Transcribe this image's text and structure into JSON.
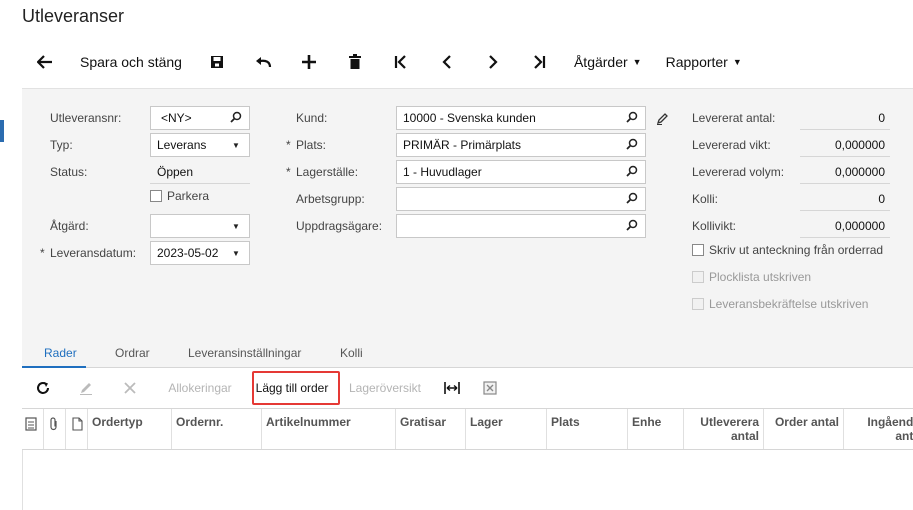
{
  "page": {
    "title": "Utleveranser"
  },
  "toolbar": {
    "save_close_label": "Spara och stäng",
    "actions_label": "Åtgärder",
    "reports_label": "Rapporter",
    "icons": [
      "back-icon",
      "save-icon",
      "undo-icon",
      "add-icon",
      "delete-icon",
      "first-record-icon",
      "previous-icon",
      "next-icon",
      "last-record-icon"
    ]
  },
  "form": {
    "shipment_nbr": {
      "label": "Utleveransnr:",
      "value": "<NY>"
    },
    "type": {
      "label": "Typ:",
      "value": "Leverans"
    },
    "status": {
      "label": "Status:",
      "value": "Öppen"
    },
    "hold": {
      "label": "Parkera"
    },
    "operation": {
      "label": "Åtgärd:",
      "value": ""
    },
    "shipment_date": {
      "label": "Leveransdatum:",
      "value": "2023-05-02"
    },
    "customer": {
      "label": "Kund:",
      "value": "10000 - Svenska kunden"
    },
    "location": {
      "label": "Plats:",
      "value": "PRIMÄR - Primärplats"
    },
    "warehouse": {
      "label": "Lagerställe:",
      "value": "1 - Huvudlager"
    },
    "workgroup": {
      "label": "Arbetsgrupp:",
      "value": ""
    },
    "owner": {
      "label": "Uppdragsägare:",
      "value": ""
    },
    "required_mark": "*"
  },
  "summary": {
    "shipped_qty": {
      "label": "Levererat antal:",
      "value": "0"
    },
    "shipped_weight": {
      "label": "Levererad vikt:",
      "value": "0,000000"
    },
    "shipped_volume": {
      "label": "Levererad volym:",
      "value": "0,000000"
    },
    "packages": {
      "label": "Kolli:",
      "value": "0"
    },
    "package_weight": {
      "label": "Kollivikt:",
      "value": "0,000000"
    },
    "print_note": {
      "label": "Skriv ut anteckning från orderrad"
    },
    "picklist_printed": {
      "label": "Plocklista utskriven"
    },
    "confirmation_printed": {
      "label": "Leveransbekräftelse utskriven"
    }
  },
  "tabs": [
    "Rader",
    "Ordrar",
    "Leveransinställningar",
    "Kolli"
  ],
  "grid_toolbar": {
    "allocations": "Allokeringar",
    "add_order": "Lägg till order",
    "inventory_summary": "Lageröversikt"
  },
  "grid": {
    "columns": [
      {
        "label": "Ordertyp"
      },
      {
        "label": "Ordernr."
      },
      {
        "label": "Artikelnummer"
      },
      {
        "label": "Gratisar"
      },
      {
        "label": "Lager"
      },
      {
        "label": "Plats"
      },
      {
        "label": "Enhe"
      },
      {
        "label": "Utleverera antal"
      },
      {
        "label": "Order antal"
      },
      {
        "label": "Ingående anta"
      }
    ]
  },
  "colors": {
    "accent": "#1f6fbf",
    "highlight": "#e53935"
  }
}
